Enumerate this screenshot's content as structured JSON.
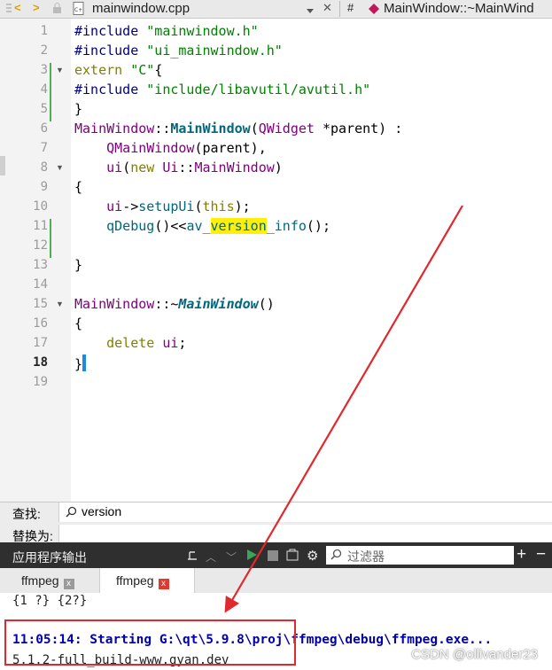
{
  "top_bar": {
    "file_name": "mainwindow.cpp",
    "symbol_hash": "#",
    "symbol": "MainWindow::~MainWind",
    "nav_back": "<",
    "nav_forward": ">",
    "close_glyph": "✕"
  },
  "editor": {
    "lines": [
      {
        "n": "1",
        "code": "#include \"mainwindow.h\""
      },
      {
        "n": "2",
        "code": "#include \"ui_mainwindow.h\""
      },
      {
        "n": "3",
        "code": "extern \"C\"{"
      },
      {
        "n": "4",
        "code": "#include \"include/libavutil/avutil.h\""
      },
      {
        "n": "5",
        "code": "}"
      },
      {
        "n": "6",
        "code": "MainWindow::MainWindow(QWidget *parent) :"
      },
      {
        "n": "7",
        "code": "QMainWindow(parent),"
      },
      {
        "n": "8",
        "code": "ui(new Ui::MainWindow)"
      },
      {
        "n": "9",
        "code": "{"
      },
      {
        "n": "10",
        "code": "ui->setupUi(this);"
      },
      {
        "n": "11",
        "code": "qDebug()<<av_version_info();"
      },
      {
        "n": "12",
        "code": ""
      },
      {
        "n": "13",
        "code": "}"
      },
      {
        "n": "14",
        "code": ""
      },
      {
        "n": "15",
        "code": "MainWindow::~MainWindow()"
      },
      {
        "n": "16",
        "code": "{"
      },
      {
        "n": "17",
        "code": "delete ui;"
      },
      {
        "n": "18",
        "code": "}"
      },
      {
        "n": "19",
        "code": ""
      }
    ],
    "current_line": "18",
    "search_highlight": "version"
  },
  "find_bar": {
    "find_label": "查找:",
    "find_value": "version",
    "replace_label": "替换为:"
  },
  "output_pane": {
    "title": "应用程序输出",
    "filter_placeholder": "过滤器",
    "add_glyph": "+",
    "minus_glyph": "−",
    "tabs": [
      {
        "label": "ffmpeg",
        "close": "x",
        "active": false
      },
      {
        "label": "ffmpeg",
        "close": "x",
        "active": true
      }
    ],
    "lines": [
      "{1 ?} {2?}",
      "11:05:14: Starting G:\\qt\\5.9.8\\proj\\ffmpeg\\debug\\ffmpeg.exe...",
      "5.1.2-full_build-www.gyan.dev"
    ]
  },
  "watermark": "CSDN @ollivander23",
  "colors": {
    "annotation_red": "#e0292e",
    "search_highlight": "#ffef0b",
    "caret_blue": "#1e88e5",
    "output_starting": "#0000aa"
  }
}
